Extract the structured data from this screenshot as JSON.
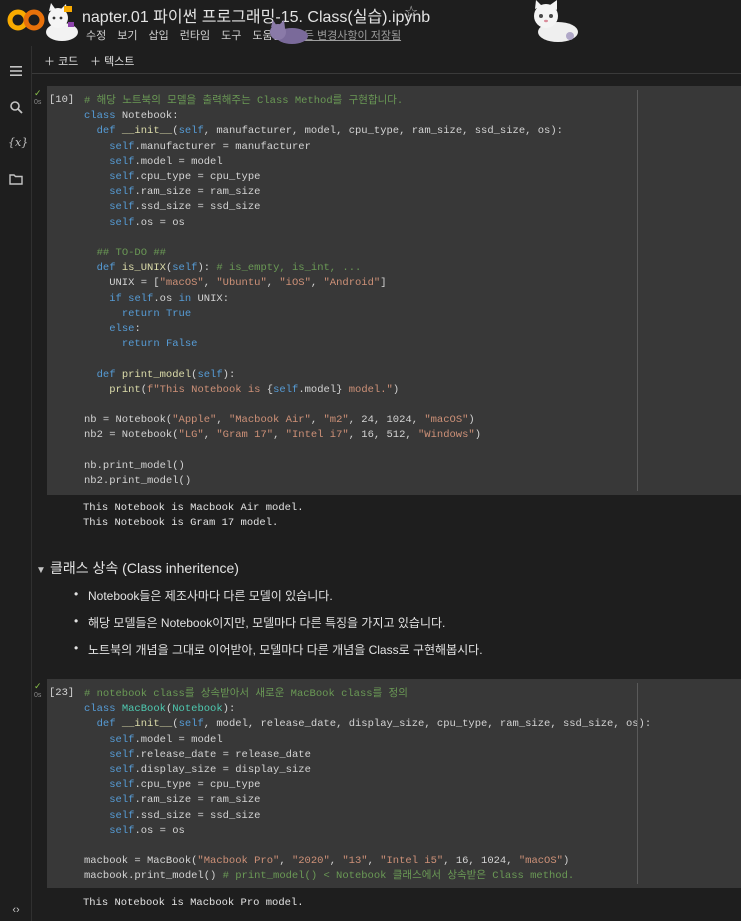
{
  "header": {
    "title": "napter.01 파이썬 프로그래밍-15. Class(실습).ipynb",
    "menu": [
      "수정",
      "보기",
      "삽입",
      "런타임",
      "도구",
      "도움말"
    ],
    "saved_status": "모든 변경사항이 저장됨"
  },
  "toolbar": {
    "code_label": "코드",
    "text_label": "텍스트"
  },
  "sidebar": {
    "icons": [
      "menu-icon",
      "search-icon",
      "variables-icon",
      "folder-icon",
      "code-icon"
    ]
  },
  "cells": [
    {
      "exec_count": "[10]",
      "run_time": "0s",
      "output": "This Notebook is Macbook Air model.\nThis Notebook is Gram 17 model."
    },
    {
      "exec_count": "[23]",
      "run_time": "0s",
      "output": "This Notebook is Macbook Pro model."
    }
  ],
  "markdown": {
    "heading": "클래스 상속 (Class inheritence)",
    "bullets": [
      "Notebook들은 제조사마다 다른 모델이 있습니다.",
      "해당 모델들은 Notebook이지만, 모델마다 다른 특징을 가지고 있습니다.",
      "노트북의 개념을 그대로 이어받아, 모델마다 다른 개념을 Class로 구현해봅시다."
    ]
  },
  "code": {
    "cell1": [
      [
        [
          "cm",
          "# 해당 노트북의 모델을 출력해주는 Class Method를 구현합니다."
        ]
      ],
      [
        [
          "kw",
          "class"
        ],
        [
          "bi",
          " Notebook:"
        ]
      ],
      [
        [
          "bi",
          "  "
        ],
        [
          "kw",
          "def"
        ],
        [
          "bi",
          " "
        ],
        [
          "fn",
          "__init__"
        ],
        [
          "bi",
          "("
        ],
        [
          "sf",
          "self"
        ],
        [
          "bi",
          ", manufacturer, model, cpu_type, ram_size, ssd_size, os):"
        ]
      ],
      [
        [
          "bi",
          "    "
        ],
        [
          "sf",
          "self"
        ],
        [
          "bi",
          ".manufacturer = manufacturer"
        ]
      ],
      [
        [
          "bi",
          "    "
        ],
        [
          "sf",
          "self"
        ],
        [
          "bi",
          ".model = model"
        ]
      ],
      [
        [
          "bi",
          "    "
        ],
        [
          "sf",
          "self"
        ],
        [
          "bi",
          ".cpu_type = cpu_type"
        ]
      ],
      [
        [
          "bi",
          "    "
        ],
        [
          "sf",
          "self"
        ],
        [
          "bi",
          ".ram_size = ram_size"
        ]
      ],
      [
        [
          "bi",
          "    "
        ],
        [
          "sf",
          "self"
        ],
        [
          "bi",
          ".ssd_size = ssd_size"
        ]
      ],
      [
        [
          "bi",
          "    "
        ],
        [
          "sf",
          "self"
        ],
        [
          "bi",
          ".os = os"
        ]
      ],
      [
        [
          "bi",
          ""
        ]
      ],
      [
        [
          "bi",
          "  "
        ],
        [
          "cm",
          "## TO-DO ##"
        ]
      ],
      [
        [
          "bi",
          "  "
        ],
        [
          "kw",
          "def"
        ],
        [
          "bi",
          " "
        ],
        [
          "fn",
          "is_UNIX"
        ],
        [
          "bi",
          "("
        ],
        [
          "sf",
          "self"
        ],
        [
          "bi",
          "): "
        ],
        [
          "cm",
          "# is_empty, is_int, ..."
        ]
      ],
      [
        [
          "bi",
          "    UNIX = ["
        ],
        [
          "st",
          "\"macOS\""
        ],
        [
          "bi",
          ", "
        ],
        [
          "st",
          "\"Ubuntu\""
        ],
        [
          "bi",
          ", "
        ],
        [
          "st",
          "\"iOS\""
        ],
        [
          "bi",
          ", "
        ],
        [
          "st",
          "\"Android\""
        ],
        [
          "bi",
          "]"
        ]
      ],
      [
        [
          "bi",
          "    "
        ],
        [
          "kw",
          "if"
        ],
        [
          "bi",
          " "
        ],
        [
          "sf",
          "self"
        ],
        [
          "bi",
          ".os "
        ],
        [
          "kw",
          "in"
        ],
        [
          "bi",
          " UNIX:"
        ]
      ],
      [
        [
          "bi",
          "      "
        ],
        [
          "kw",
          "return"
        ],
        [
          "bi",
          " "
        ],
        [
          "kw",
          "True"
        ]
      ],
      [
        [
          "bi",
          "    "
        ],
        [
          "kw",
          "else"
        ],
        [
          "bi",
          ":"
        ]
      ],
      [
        [
          "bi",
          "      "
        ],
        [
          "kw",
          "return"
        ],
        [
          "bi",
          " "
        ],
        [
          "kw",
          "False"
        ]
      ],
      [
        [
          "bi",
          ""
        ]
      ],
      [
        [
          "bi",
          "  "
        ],
        [
          "kw",
          "def"
        ],
        [
          "bi",
          " "
        ],
        [
          "fn",
          "print_model"
        ],
        [
          "bi",
          "("
        ],
        [
          "sf",
          "self"
        ],
        [
          "bi",
          "):"
        ]
      ],
      [
        [
          "bi",
          "    "
        ],
        [
          "fn",
          "print"
        ],
        [
          "bi",
          "("
        ],
        [
          "st",
          "f\"This Notebook is "
        ],
        [
          "bi",
          "{"
        ],
        [
          "sf",
          "self"
        ],
        [
          "bi",
          ".model}"
        ],
        [
          "st",
          " model.\""
        ],
        [
          "bi",
          ")"
        ]
      ],
      [
        [
          "bi",
          ""
        ]
      ],
      [
        [
          "bi",
          "nb = Notebook("
        ],
        [
          "st",
          "\"Apple\""
        ],
        [
          "bi",
          ", "
        ],
        [
          "st",
          "\"Macbook Air\""
        ],
        [
          "bi",
          ", "
        ],
        [
          "st",
          "\"m2\""
        ],
        [
          "bi",
          ", 24, 1024, "
        ],
        [
          "st",
          "\"macOS\""
        ],
        [
          "bi",
          ")"
        ]
      ],
      [
        [
          "bi",
          "nb2 = Notebook("
        ],
        [
          "st",
          "\"LG\""
        ],
        [
          "bi",
          ", "
        ],
        [
          "st",
          "\"Gram 17\""
        ],
        [
          "bi",
          ", "
        ],
        [
          "st",
          "\"Intel i7\""
        ],
        [
          "bi",
          ", 16, 512, "
        ],
        [
          "st",
          "\"Windows\""
        ],
        [
          "bi",
          ")"
        ]
      ],
      [
        [
          "bi",
          ""
        ]
      ],
      [
        [
          "bi",
          "nb.print_model()"
        ]
      ],
      [
        [
          "bi",
          "nb2.print_model()"
        ]
      ]
    ],
    "cell2": [
      [
        [
          "cm",
          "# notebook class를 상속받아서 새로운 MacBook class를 정의"
        ]
      ],
      [
        [
          "kw",
          "class"
        ],
        [
          "bi",
          " "
        ],
        [
          "cl",
          "MacBook"
        ],
        [
          "bi",
          "("
        ],
        [
          "cl",
          "Notebook"
        ],
        [
          "bi",
          "):"
        ]
      ],
      [
        [
          "bi",
          "  "
        ],
        [
          "kw",
          "def"
        ],
        [
          "bi",
          " "
        ],
        [
          "fn",
          "__init__"
        ],
        [
          "bi",
          "("
        ],
        [
          "sf",
          "self"
        ],
        [
          "bi",
          ", model, release_date, display_size, cpu_type, ram_size, ssd_size, os):"
        ]
      ],
      [
        [
          "bi",
          "    "
        ],
        [
          "sf",
          "self"
        ],
        [
          "bi",
          ".model = model"
        ]
      ],
      [
        [
          "bi",
          "    "
        ],
        [
          "sf",
          "self"
        ],
        [
          "bi",
          ".release_date = release_date"
        ]
      ],
      [
        [
          "bi",
          "    "
        ],
        [
          "sf",
          "self"
        ],
        [
          "bi",
          ".display_size = display_size"
        ]
      ],
      [
        [
          "bi",
          "    "
        ],
        [
          "sf",
          "self"
        ],
        [
          "bi",
          ".cpu_type = cpu_type"
        ]
      ],
      [
        [
          "bi",
          "    "
        ],
        [
          "sf",
          "self"
        ],
        [
          "bi",
          ".ram_size = ram_size"
        ]
      ],
      [
        [
          "bi",
          "    "
        ],
        [
          "sf",
          "self"
        ],
        [
          "bi",
          ".ssd_size = ssd_size"
        ]
      ],
      [
        [
          "bi",
          "    "
        ],
        [
          "sf",
          "self"
        ],
        [
          "bi",
          ".os = os"
        ]
      ],
      [
        [
          "bi",
          ""
        ]
      ],
      [
        [
          "bi",
          "macbook = MacBook("
        ],
        [
          "st",
          "\"Macbook Pro\""
        ],
        [
          "bi",
          ", "
        ],
        [
          "st",
          "\"2020\""
        ],
        [
          "bi",
          ", "
        ],
        [
          "st",
          "\"13\""
        ],
        [
          "bi",
          ", "
        ],
        [
          "st",
          "\"Intel i5\""
        ],
        [
          "bi",
          ", 16, 1024, "
        ],
        [
          "st",
          "\"macOS\""
        ],
        [
          "bi",
          ")"
        ]
      ],
      [
        [
          "bi",
          "macbook.print_model() "
        ],
        [
          "cm",
          "# print_model() < Notebook 클래스에서 상속받은 Class method."
        ]
      ]
    ]
  },
  "colors": {
    "accent": "#f9ab00",
    "comment": "#6a9955",
    "keyword": "#569cd6",
    "string": "#ce9178"
  }
}
